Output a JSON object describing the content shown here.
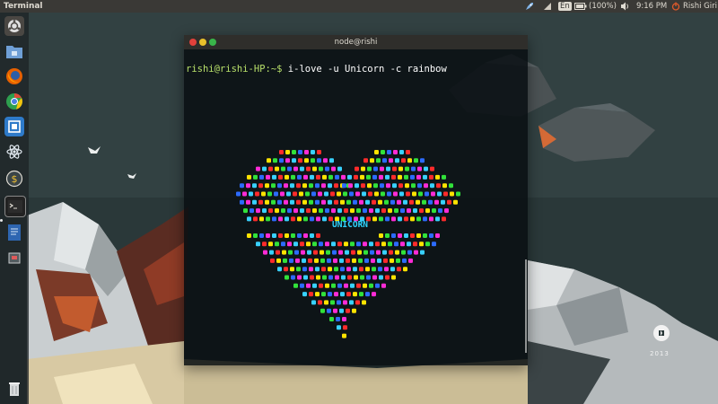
{
  "panel": {
    "app_title": "Terminal",
    "keyboard_layout": "En",
    "battery": "(100%)",
    "time": "9:16 PM",
    "user": "Rishi Giri",
    "icons": [
      "rocket-icon",
      "wifi-icon",
      "keyboard-icon",
      "battery-icon",
      "volume-icon",
      "power-icon"
    ]
  },
  "launcher": {
    "items": [
      "ubuntu-dash-icon",
      "files-icon",
      "firefox-icon",
      "chrome-icon",
      "terminal-app-icon",
      "atom-icon",
      "money-icon",
      "terminal-icon",
      "doc-icon",
      "files2-icon",
      "trash-icon"
    ]
  },
  "terminal": {
    "title": "node@rishi",
    "prompt": "rishi@rishi-HP:~$ ",
    "command": "i-love -u Unicorn -c rainbow",
    "word": "UNICORN",
    "colors": [
      "#ff2b2b",
      "#ffe400",
      "#31e23a",
      "#2c6bff",
      "#ff2bd6",
      "#38d1ff"
    ]
  },
  "wallpaper": {
    "year": "2013"
  }
}
